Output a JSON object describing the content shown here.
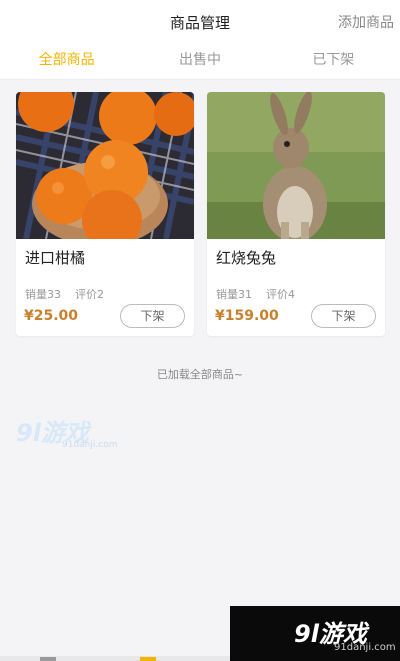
{
  "header": {
    "title": "商品管理",
    "action_label": "添加商品"
  },
  "tabs": [
    {
      "label": "全部商品",
      "active": true
    },
    {
      "label": "出售中",
      "active": false
    },
    {
      "label": "已下架",
      "active": false
    }
  ],
  "products": [
    {
      "name": "进口柑橘",
      "sales": "销量33",
      "reviews": "评价2",
      "price": "¥25.00",
      "action_label": "下架",
      "image": "oranges-photo"
    },
    {
      "name": "红烧兔兔",
      "sales": "销量31",
      "reviews": "评价4",
      "price": "¥159.00",
      "action_label": "下架",
      "image": "rabbit-photo"
    }
  ],
  "footer_message": "已加载全部商品~",
  "watermark": {
    "logo_text": "9l游戏",
    "site": "91danji.com"
  },
  "colors": {
    "accent": "#f5b400",
    "price": "#c8802c"
  }
}
